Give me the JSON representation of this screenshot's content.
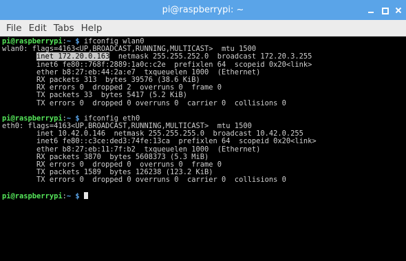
{
  "window": {
    "title": "pi@raspberrypi: ~",
    "controls": {
      "minimize": "_",
      "maximize": "□",
      "close": "×"
    }
  },
  "menu": {
    "file": "File",
    "edit": "Edit",
    "tabs": "Tabs",
    "help": "Help"
  },
  "colors": {
    "titlebar": "#5aa4e8",
    "terminal_bg": "#000000",
    "prompt_user": "#55e65a",
    "prompt_path": "#5aa4e8",
    "text": "#d0d0d0",
    "selection": "#c8c8c8"
  },
  "terminal": {
    "prompt_user": "pi@raspberrypi",
    "prompt_sep": ":",
    "prompt_path": "~",
    "prompt_dollar": " $ ",
    "cmd1": "ifconfig wlan0",
    "wlan0": {
      "l1": "wlan0: flags=4163<UP,BROADCAST,RUNNING,MULTICAST>  mtu 1500",
      "l2_indent": "        ",
      "l2_highlight": "inet 172.20.0.163",
      "l2_rest": "  netmask 255.255.252.0  broadcast 172.20.3.255",
      "l3": "        inet6 fe80::768f:2889:1a0c:c2e  prefixlen 64  scopeid 0x20<link>",
      "l4": "        ether b8:27:eb:44:2a:e7  txqueuelen 1000  (Ethernet)",
      "l5": "        RX packets 313  bytes 39576 (38.6 KiB)",
      "l6": "        RX errors 0  dropped 2  overruns 0  frame 0",
      "l7": "        TX packets 33  bytes 5417 (5.2 KiB)",
      "l8": "        TX errors 0  dropped 0 overruns 0  carrier 0  collisions 0"
    },
    "cmd2": "ifconfig eth0",
    "eth0": {
      "l1": "eth0: flags=4163<UP,BROADCAST,RUNNING,MULTICAST>  mtu 1500",
      "l2": "        inet 10.42.0.146  netmask 255.255.255.0  broadcast 10.42.0.255",
      "l3": "        inet6 fe80::c3ce:ded3:74fe:13ca  prefixlen 64  scopeid 0x20<link>",
      "l4": "        ether b8:27:eb:11:7f:b2  txqueuelen 1000  (Ethernet)",
      "l5": "        RX packets 3870  bytes 5608373 (5.3 MiB)",
      "l6": "        RX errors 0  dropped 0  overruns 0  frame 0",
      "l7": "        TX packets 1589  bytes 126238 (123.2 KiB)",
      "l8": "        TX errors 0  dropped 0 overruns 0  carrier 0  collisions 0"
    }
  }
}
